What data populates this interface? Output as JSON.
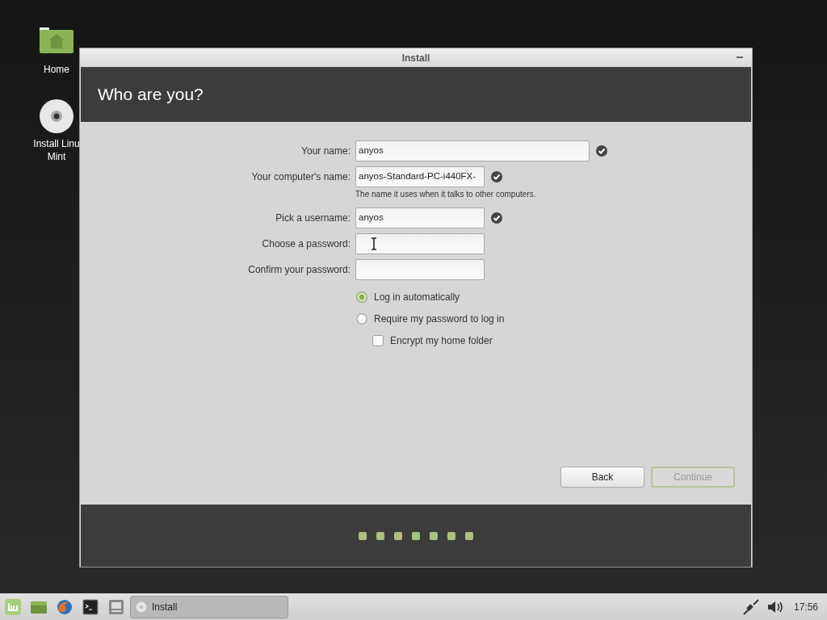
{
  "desktop_icons": [
    {
      "kind": "home",
      "label_lines": [
        "Home"
      ]
    },
    {
      "kind": "disc",
      "label_lines": [
        "Install Linu",
        "Mint"
      ]
    }
  ],
  "window": {
    "title": "Install",
    "heading": "Who are you?"
  },
  "form": {
    "fields": [
      {
        "label": "Your name:",
        "value": "anyos",
        "wide": true,
        "valid": true
      },
      {
        "label": "Your computer's name:",
        "value": "anyos-Standard-PC-i440FX-",
        "wide": false,
        "valid": true,
        "hint": "The name it uses when it talks to other computers."
      },
      {
        "label": "Pick a username:",
        "value": "anyos",
        "wide": false,
        "valid": true
      },
      {
        "label": "Choose a password:",
        "wide": false,
        "valid": false,
        "cursor": true
      },
      {
        "label": "Confirm your password:",
        "wide": false,
        "valid": false
      }
    ],
    "options": [
      {
        "kind": "radio",
        "label": "Log in automatically",
        "selected": true
      },
      {
        "kind": "radio",
        "label": "Require my password to log in",
        "selected": false
      },
      {
        "kind": "checkbox",
        "label": "Encrypt my home folder",
        "checked": false
      }
    ]
  },
  "buttons": [
    {
      "label": "Back",
      "disabled": false
    },
    {
      "label": "Continue",
      "disabled": true
    }
  ],
  "progress_steps": [
    {
      "kind": "step"
    },
    {
      "kind": "step"
    },
    {
      "kind": "step"
    },
    {
      "kind": "step"
    },
    {
      "kind": "step"
    },
    {
      "kind": "step"
    },
    {
      "kind": "step"
    }
  ],
  "taskbar": {
    "launchers": [
      {
        "kind": "mint"
      },
      {
        "kind": "files"
      },
      {
        "kind": "browser"
      },
      {
        "kind": "terminal"
      },
      {
        "kind": "desktop"
      }
    ],
    "windows": [
      {
        "label": "Install",
        "selected": true
      }
    ],
    "tray": [
      {
        "kind": "network"
      },
      {
        "kind": "volume"
      }
    ],
    "clock": "17:56"
  }
}
